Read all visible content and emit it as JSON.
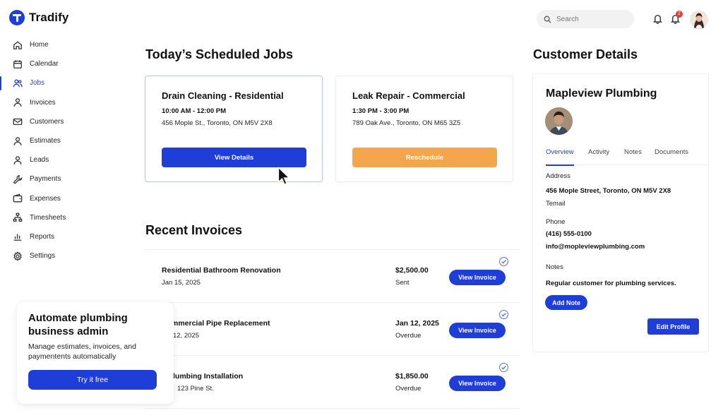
{
  "app": {
    "name": "Tradify",
    "brand_color": "#1f3ed8",
    "accent_orange": "#f3a64c"
  },
  "sidebar": {
    "items": [
      {
        "label": "Home",
        "icon": "home-icon"
      },
      {
        "label": "Calendar",
        "icon": "calendar-icon"
      },
      {
        "label": "Jobs",
        "icon": "users-icon",
        "active": true
      },
      {
        "label": "Invoices",
        "icon": "person-icon"
      },
      {
        "label": "Customers",
        "icon": "mail-icon"
      },
      {
        "label": "Estimates",
        "icon": "person-icon"
      },
      {
        "label": "Leads",
        "icon": "person-icon"
      },
      {
        "label": "Payments",
        "icon": "wrench-icon"
      },
      {
        "label": "Expenses",
        "icon": "wallet-icon"
      },
      {
        "label": "Timesheets",
        "icon": "network-icon"
      },
      {
        "label": "Reports",
        "icon": "chart-icon"
      },
      {
        "label": "Settings",
        "icon": "gear-icon"
      }
    ]
  },
  "header": {
    "search_placeholder": "Search",
    "notification_count": "2"
  },
  "scheduled": {
    "title": "Today’s Scheduled Jobs",
    "jobs": [
      {
        "title": "Drain Cleaning - Residential",
        "time": "10:00 AM - 12:00 PM",
        "address": "456 Mople St., Toronto, ON M5V 2X8",
        "action": "View Details"
      },
      {
        "title": "Leak Repair - Commercial",
        "time": "1:30 PM - 3:00 PM",
        "address": "789 Oak Ave., Toronto, ON M65 3Z5",
        "action": "Reschedule"
      }
    ]
  },
  "invoices": {
    "title": "Recent Invoices",
    "rows": [
      {
        "title": "Residential Bathroom Renovation",
        "date": "Jan 15, 2025",
        "amount": "$2,500.00",
        "status": "Sent",
        "action": "View Invoice"
      },
      {
        "title": "Commercial Pipe Replacement",
        "date": "12, 2025",
        "amount": "Jan 12, 2025",
        "status": "Overdue",
        "action": "View Invoice"
      },
      {
        "title": "lumbing Installation",
        "date": "123 Pine St.",
        "amount": "$1,850.00",
        "status": "Overdue",
        "action": "View Invoice"
      }
    ]
  },
  "customer": {
    "section_title": "Customer Details",
    "name": "Mapleview Plumbing",
    "tabs": [
      "Overview",
      "Activity",
      "Notes",
      "Documents"
    ],
    "address_label": "Address",
    "address": "456 Mople Street, Toronto, ON M5V 2X8",
    "email_label": "Temail",
    "phone_label": "Phone",
    "phone": "(416) 555-0100",
    "email": "info@mopleviewplumbing.com",
    "notes_label": "Notes",
    "notes": "Regular customer for plumbing services.",
    "add_note": "Add Note",
    "edit_profile": "Edit Profile"
  },
  "promo": {
    "title": "Automate plumbing business admin",
    "description": "Manage estimates, invoices, and paymentents automatically",
    "cta": "Try it free"
  }
}
